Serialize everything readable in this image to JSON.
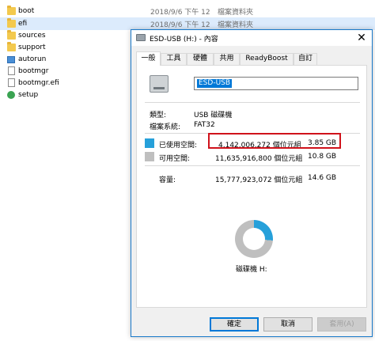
{
  "files": [
    {
      "name": "boot",
      "date": "2018/9/6 下午 12",
      "type": "檔案資料夾",
      "icon": "folder-icon"
    },
    {
      "name": "efi",
      "date": "2018/9/6 下午 12",
      "type": "檔案資料夾",
      "icon": "folder-icon"
    },
    {
      "name": "sources",
      "date": "",
      "type": "",
      "icon": "folder-icon"
    },
    {
      "name": "support",
      "date": "",
      "type": "",
      "icon": "folder-icon"
    },
    {
      "name": "autorun",
      "date": "",
      "type": "",
      "icon": "app-icon"
    },
    {
      "name": "bootmgr",
      "date": "",
      "type": "",
      "icon": "file-icon"
    },
    {
      "name": "bootmgr.efi",
      "date": "",
      "type": "",
      "icon": "file-icon"
    },
    {
      "name": "setup",
      "date": "",
      "type": "",
      "icon": "setup-icon"
    }
  ],
  "dialog": {
    "title": "ESD-USB (H:) - 內容",
    "close": "✕",
    "tabs": [
      "一般",
      "工具",
      "硬體",
      "共用",
      "ReadyBoost",
      "自訂"
    ],
    "volume_name": "ESD-USB",
    "type_label": "類型:",
    "type_value": "USB 磁碟機",
    "fs_label": "檔案系統:",
    "fs_value": "FAT32",
    "used_label": "已使用空間:",
    "used_bytes": "4,142,006,272 個位元組",
    "used_size": "3.85 GB",
    "free_label": "可用空間:",
    "free_bytes": "11,635,916,800 個位元組",
    "free_size": "10.8 GB",
    "cap_label": "容量:",
    "cap_bytes": "15,777,923,072 個位元組",
    "cap_size": "14.6 GB",
    "drive_label": "磁碟機 H:",
    "used_fraction": 0.2625,
    "buttons": {
      "ok": "確定",
      "cancel": "取消",
      "apply": "套用(A)"
    }
  },
  "colors": {
    "used": "#26a0da",
    "free": "#bfbfbf",
    "accent": "#0078d7",
    "highlight": "#d0121b"
  }
}
